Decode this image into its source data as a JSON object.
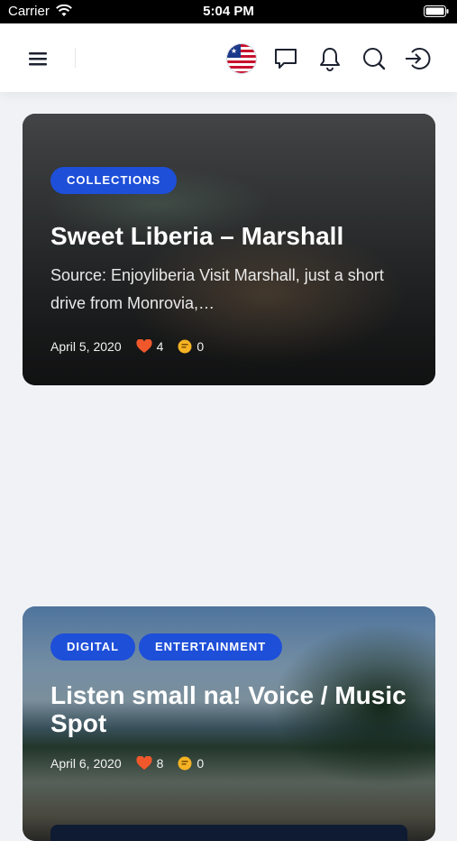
{
  "status_bar": {
    "carrier": "Carrier",
    "time": "5:04 PM"
  },
  "header": {
    "icons": [
      "menu-icon",
      "liberia-flag-icon",
      "chat-icon",
      "bell-icon",
      "search-icon",
      "sign-in-icon"
    ],
    "colors": {
      "accent": "#1e4fd8"
    }
  },
  "posts": [
    {
      "categories": [
        "COLLECTIONS"
      ],
      "title": "Sweet Liberia – Marshall",
      "excerpt": "Source: Enjoyliberia Visit Marshall, just a short drive from Monrovia,…",
      "date": "April 5, 2020",
      "likes": "4",
      "comments": "0"
    },
    {
      "categories": [
        "DIGITAL",
        "ENTERTAINMENT"
      ],
      "title_line1": "Listen small na! Voice / Music",
      "title_line2": "Spot",
      "date": "April 6, 2020",
      "likes": "8",
      "comments": "0"
    }
  ]
}
